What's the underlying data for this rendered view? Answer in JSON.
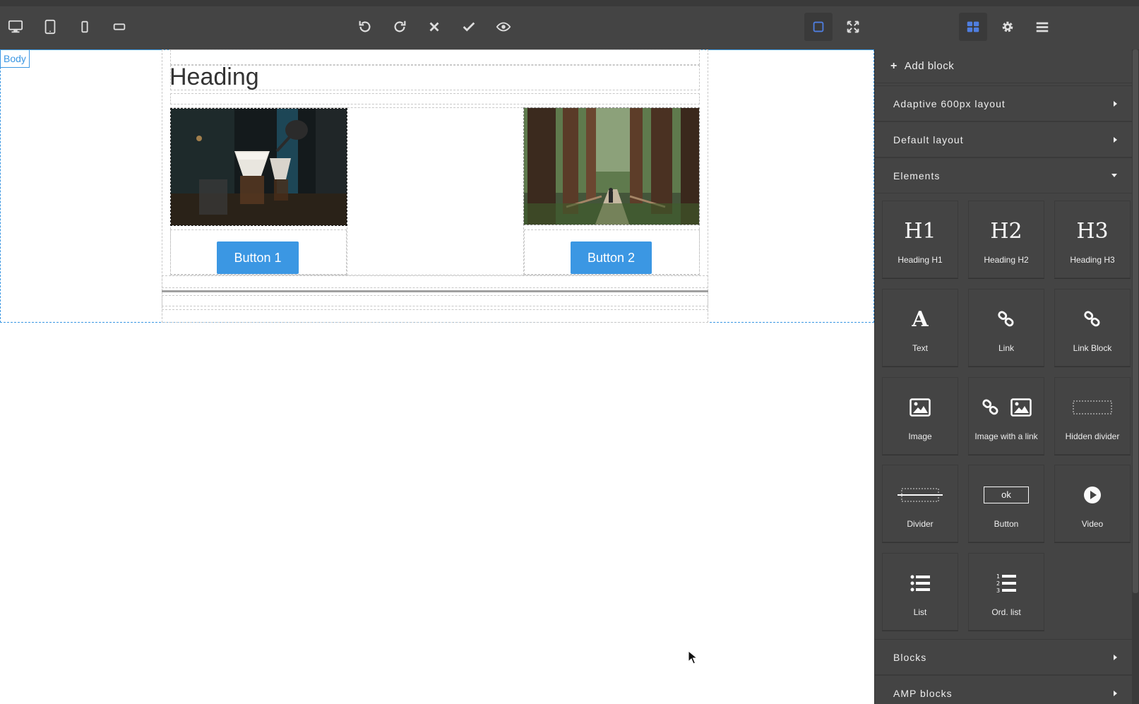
{
  "toolbar": {
    "devices": [
      "desktop-icon",
      "tablet-icon",
      "mobile-portrait-icon",
      "mobile-landscape-icon"
    ],
    "actions": [
      "undo-icon",
      "redo-icon",
      "clear-icon",
      "save-icon",
      "preview-icon"
    ],
    "view": [
      "outline-icon",
      "fullscreen-icon"
    ],
    "panels": [
      "blocks-icon",
      "settings-icon",
      "layers-icon"
    ]
  },
  "canvas": {
    "body_badge": "Body",
    "heading": "Heading",
    "button1": "Button 1",
    "button2": "Button 2"
  },
  "panel": {
    "add_block": "Add block",
    "categories": {
      "adaptive": "Adaptive 600px layout",
      "default": "Default layout",
      "elements": "Elements",
      "blocks": "Blocks",
      "amp": "AMP blocks"
    },
    "tiles": {
      "h1": {
        "glyph": "H1",
        "label": "Heading H1"
      },
      "h2": {
        "glyph": "H2",
        "label": "Heading H2"
      },
      "h3": {
        "glyph": "H3",
        "label": "Heading H3"
      },
      "text": {
        "glyph": "A",
        "label": "Text"
      },
      "link": {
        "label": "Link"
      },
      "link_block": {
        "label": "Link Block"
      },
      "image": {
        "label": "Image"
      },
      "image_link": {
        "label": "Image with a link"
      },
      "hidden_divider": {
        "label": "Hidden divider"
      },
      "divider": {
        "label": "Divider"
      },
      "button": {
        "glyph": "ok",
        "label": "Button"
      },
      "video": {
        "label": "Video"
      },
      "list": {
        "label": "List"
      },
      "ord_list": {
        "label": "Ord. list"
      }
    }
  },
  "colors": {
    "accent": "#3b97e3",
    "toolbar_bg": "#444444",
    "active_icon": "#4f7ee0"
  }
}
